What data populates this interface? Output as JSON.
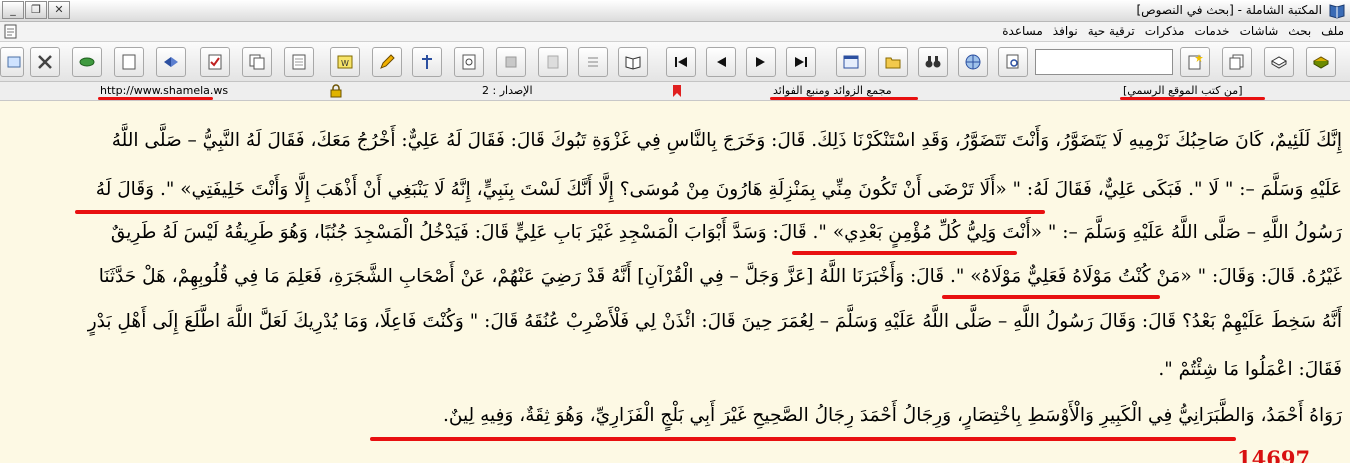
{
  "window": {
    "title": "المكتبة الشاملة - [بحث في النصوص]",
    "controls": [
      "_",
      "❐",
      "✕"
    ]
  },
  "menu": {
    "items": [
      "ملف",
      "بحث",
      "شاشات",
      "خدمات",
      "مذكرات",
      "ترقية حية",
      "نوافذ",
      "مساعدة"
    ]
  },
  "toolbar": {
    "search_value": ""
  },
  "infobar": {
    "source": "[من كتب الموقع الرسمي]",
    "book_title": "مجمع الزوائد ومنبع الفوائد",
    "version": "الإصدار : 2",
    "website": "http://www.shamela.ws"
  },
  "content": {
    "lines": [
      "إِنَّكَ لَلَئِيمٌ، كَانَ صَاحِبُكَ نَرْمِيهِ لَا يَتَضَوَّرُ، وَأَنْتَ تَتَضَوَّرُ، وَقَدِ اسْتَنْكَرْنَا ذَلِكَ. قَالَ: وَخَرَجَ بِالنَّاسِ فِي غَزْوَةِ تَبُوكَ قَالَ: فَقَالَ لَهُ عَلِيٌّ: أَخْرُجُ مَعَكَ، فَقَالَ لَهُ النَّبِيُّ – صَلَّى اللَّهُ",
      "عَلَيْهِ وَسَلَّمَ –: \" لَا \". فَبَكَى عَلِيٌّ، فَقَالَ لَهُ: \" «أَلَا تَرْضَى أَنْ تَكُونَ مِنِّي بِمَنْزِلَةِ هَارُونَ مِنْ مُوسَى؟ إِلَّا أَنَّكَ لَسْتَ بِنَبِيٍّ، إِنَّهُ لَا يَنْبَغِي أَنْ أَذْهَبَ إِلَّا وَأَنْتَ خَلِيفَتِي» \". وَقَالَ لَهُ",
      "رَسُولُ اللَّهِ – صَلَّى اللَّهُ عَلَيْهِ وَسَلَّمَ –: \" «أَنْتَ وَلِيُّ كُلِّ مُؤْمِنٍ بَعْدِي» \". قَالَ: وَسَدَّ أَبْوَابَ الْمَسْجِدِ غَيْرَ بَابِ عَلِيٍّ قَالَ: فَيَدْخُلُ الْمَسْجِدَ جُنُبًا، وَهُوَ طَرِيقُهُ لَيْسَ لَهُ طَرِيقٌ",
      "غَيْرُهُ. قَالَ: وَقَالَ: \" «مَنْ كُنْتُ مَوْلَاهُ فَعَلِيٌّ مَوْلَاهُ» \". قَالَ: وَأَخْبَرَنَا اللَّهُ [عَزَّ وَجَلَّ – فِي الْقُرْآنِ] أَنَّهُ قَدْ رَضِيَ عَنْهُمْ، عَنْ أَصْحَابِ الشَّجَرَةِ، فَعَلِمَ مَا فِي قُلُوبِهِمْ، هَلْ حَدَّثَنَا",
      "أَنَّهُ سَخِطَ عَلَيْهِمْ بَعْدُ؟ قَالَ: وَقَالَ رَسُولُ اللَّهِ – صَلَّى اللَّهُ عَلَيْهِ وَسَلَّمَ – لِعُمَرَ حِينَ قَالَ: ائْذَنْ لِي فَلْأَضْرِبْ عُنُقَهُ قَالَ: \" وَكُنْتَ فَاعِلًا، وَمَا يُدْرِيكَ لَعَلَّ اللَّهَ اطَّلَعَ إِلَى أَهْلِ بَدْرٍ",
      "فَقَالَ: اعْمَلُوا مَا شِئْتُمْ \".",
      "رَوَاهُ أَحْمَدُ، وَالطَّبَرَانِيُّ فِي الْكَبِيرِ وَالْأَوْسَطِ بِاخْتِصَارٍ، وَرِجَالُ أَحْمَدَ رِجَالُ الصَّحِيحِ غَيْرَ أَبِي بَلْجٍ الْفَزَارِيِّ، وَهُوَ ثِقَةٌ، وَفِيهِ لِينٌ."
    ],
    "next_hadith_number": "14697"
  },
  "colors": {
    "background": "#fdf9e4",
    "underline": "#e81010",
    "number": "#d81010"
  }
}
